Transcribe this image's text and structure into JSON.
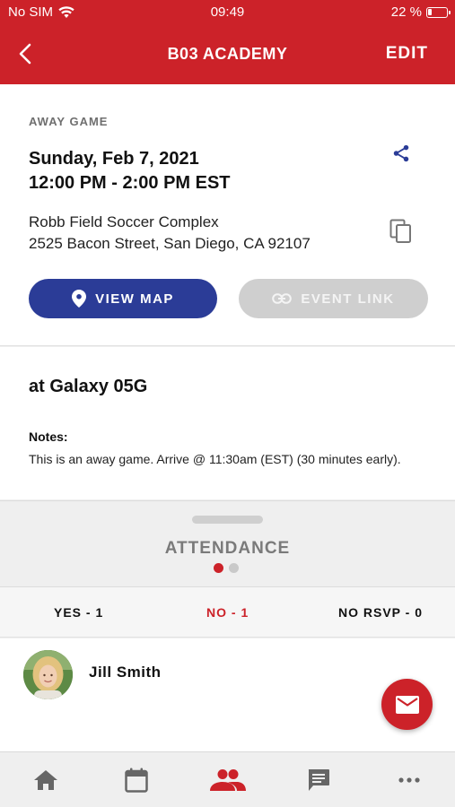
{
  "status_bar": {
    "carrier": "No SIM",
    "time": "09:49",
    "battery": "22 %",
    "battery_level": 0.22
  },
  "header": {
    "title": "B03 ACADEMY",
    "edit_label": "EDIT"
  },
  "event": {
    "type": "AWAY GAME",
    "date": "Sunday, Feb 7, 2021",
    "time_range": "12:00 PM - 2:00 PM EST",
    "venue_name": "Robb Field Soccer Complex",
    "venue_address": "2525 Bacon Street, San Diego, CA 92107",
    "view_map_label": "VIEW MAP",
    "event_link_label": "EVENT LINK"
  },
  "details": {
    "opponent": "at Galaxy 05G",
    "notes_label": "Notes:",
    "notes_text": "This is an away game. Arrive @ 11:30am (EST) (30 minutes early)."
  },
  "attendance": {
    "title": "ATTENDANCE",
    "tabs": [
      {
        "label": "YES - 1"
      },
      {
        "label": "NO - 1"
      },
      {
        "label": "NO RSVP - 0"
      }
    ],
    "people": [
      {
        "name": "Jill Smith"
      }
    ]
  },
  "colors": {
    "brand": "#cc2229",
    "primary_button": "#2b3c97",
    "disabled_button": "#cfcfcf"
  },
  "icons": {
    "header": [
      "back-arrow-icon"
    ],
    "event": [
      "share-icon",
      "copy-icon",
      "map-pin-icon",
      "link-icon"
    ],
    "fab": "mail-icon",
    "bottom_nav": [
      "home-icon",
      "calendar-icon",
      "team-icon",
      "chat-icon",
      "more-icon"
    ]
  }
}
